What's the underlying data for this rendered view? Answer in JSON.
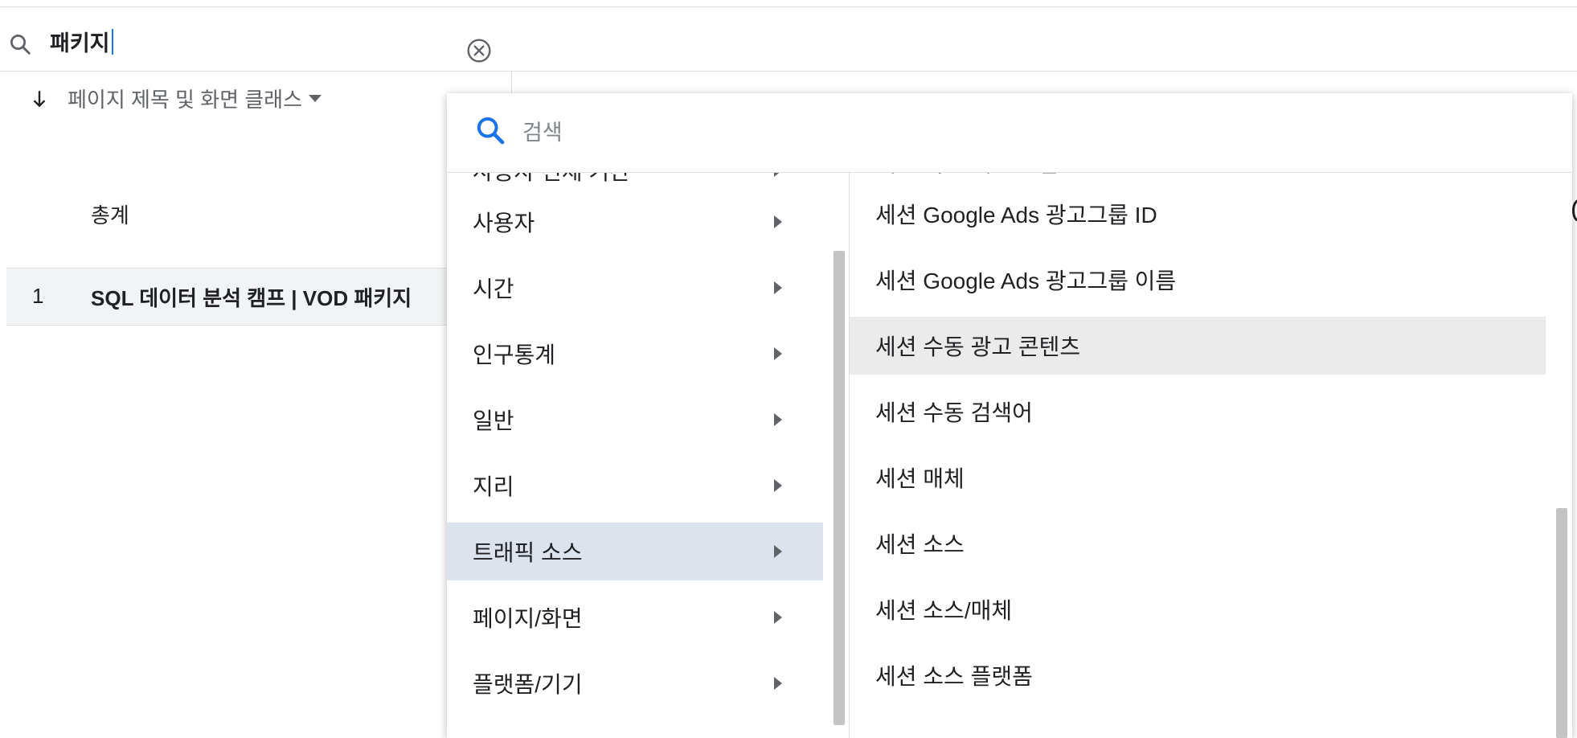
{
  "top_search": {
    "query": "패키지"
  },
  "sort": {
    "label": "페이지 제목 및 화면 클래스"
  },
  "table": {
    "total_label": "총계",
    "rows": [
      {
        "index": "1",
        "text": "SQL 데이터 분석 캠프 | VOD 패키지"
      }
    ]
  },
  "dropdown": {
    "search_placeholder": "검색",
    "categories": [
      {
        "label": "사용자 전체 기간"
      },
      {
        "label": "사용자"
      },
      {
        "label": "시간"
      },
      {
        "label": "인구통계"
      },
      {
        "label": "일반"
      },
      {
        "label": "지리"
      },
      {
        "label": "트래픽 소스",
        "selected": true
      },
      {
        "label": "페이지/화면"
      },
      {
        "label": "플랫폼/기기"
      }
    ],
    "dimensions": [
      {
        "label": "세션 기본 채널 그룹"
      },
      {
        "label": "세션 Google Ads 광고그룹 ID"
      },
      {
        "label": "세션 Google Ads 광고그룹 이름"
      },
      {
        "label": "세션 수동 광고 콘텐츠",
        "hovered": true
      },
      {
        "label": "세션 수동 검색어"
      },
      {
        "label": "세션 매체"
      },
      {
        "label": "세션 소스"
      },
      {
        "label": "세션 소스/매체"
      },
      {
        "label": "세션 소스 플랫폼"
      }
    ]
  },
  "colors": {
    "accent": "#1a73e8",
    "selected_bg": "#dde3ed",
    "hover_bg": "#ebebeb"
  },
  "icons": {
    "top_search": "search-icon",
    "clear": "clear-circle-icon",
    "sort": "arrow-down-icon",
    "dropdown_search": "search-icon",
    "submenu": "chevron-right-icon"
  }
}
